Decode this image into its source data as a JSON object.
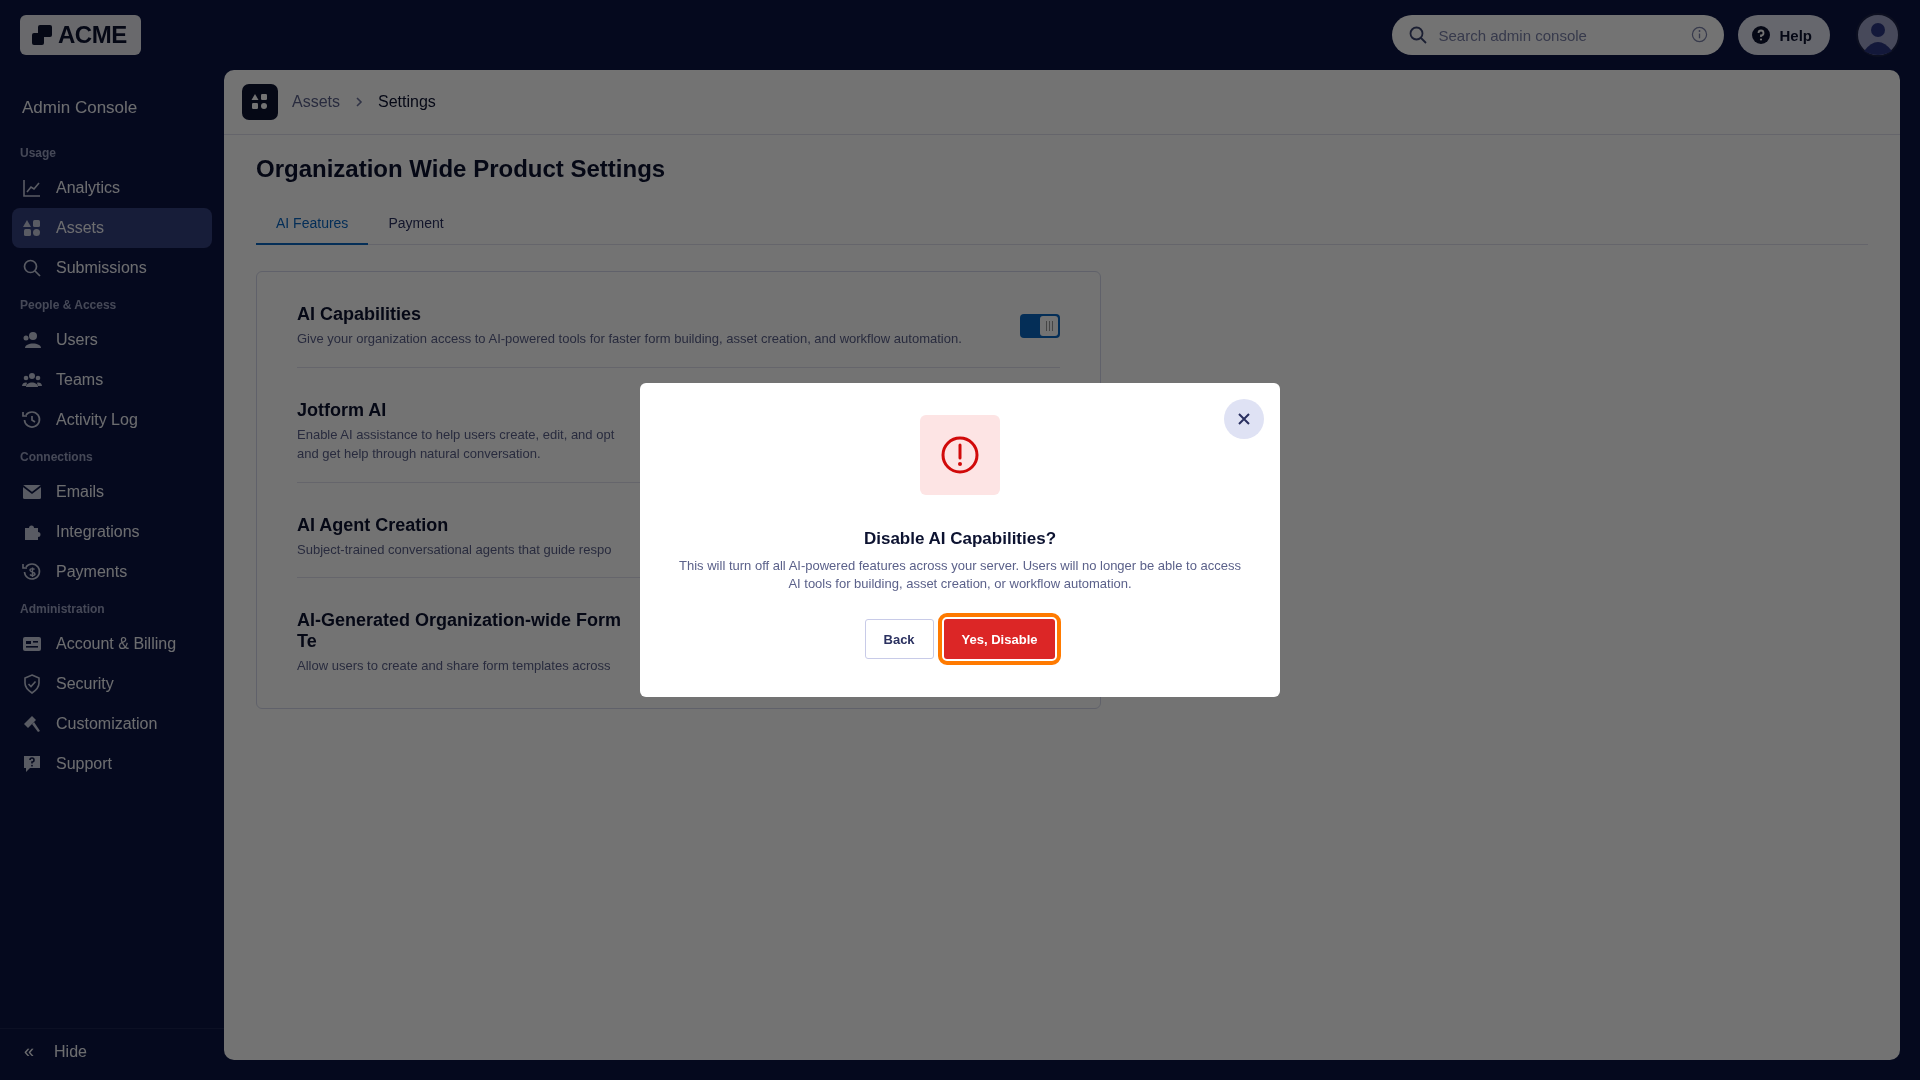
{
  "brand": {
    "logo_text": "ACME"
  },
  "search": {
    "placeholder": "Search admin console"
  },
  "help_button": {
    "label": "Help"
  },
  "sidebar": {
    "title": "Admin Console",
    "sections": [
      {
        "heading": "Usage",
        "items": [
          {
            "label": "Analytics",
            "selected": false
          },
          {
            "label": "Assets",
            "selected": true
          },
          {
            "label": "Submissions",
            "selected": false
          }
        ]
      },
      {
        "heading": "People & Access",
        "items": [
          {
            "label": "Users",
            "selected": false
          },
          {
            "label": "Teams",
            "selected": false
          },
          {
            "label": "Activity Log",
            "selected": false
          }
        ]
      },
      {
        "heading": "Connections",
        "items": [
          {
            "label": "Emails",
            "selected": false
          },
          {
            "label": "Integrations",
            "selected": false
          },
          {
            "label": "Payments",
            "selected": false
          }
        ]
      },
      {
        "heading": "Administration",
        "items": [
          {
            "label": "Account & Billing",
            "selected": false
          },
          {
            "label": "Security",
            "selected": false
          },
          {
            "label": "Customization",
            "selected": false
          },
          {
            "label": "Support",
            "selected": false
          }
        ]
      }
    ],
    "collapse": {
      "icon": "«",
      "label": "Hide"
    }
  },
  "breadcrumb": [
    "Assets",
    "Settings"
  ],
  "page_title": "Organization Wide Product Settings",
  "tabs": [
    {
      "label": "AI Features",
      "selected": true
    },
    {
      "label": "Payment",
      "selected": false
    }
  ],
  "settings": [
    {
      "kind": "toggle",
      "title": "AI Capabilities",
      "description": "Give your organization access to AI-powered tools for faster form building, asset creation, and workflow automation.",
      "on": true
    },
    {
      "kind": "plain",
      "title": "Jotform AI",
      "description": "Enable AI assistance to help users create, edit, and opt and get help through natural conversation."
    },
    {
      "kind": "plain",
      "title": "AI Agent Creation",
      "description": "Subject-trained conversational agents that guide respo"
    },
    {
      "kind": "plain",
      "title": "AI-Generated Organization-wide Form Te",
      "description": "Allow users to create and share form templates across"
    }
  ],
  "dialog": {
    "title": "Disable AI Capabilities?",
    "message": "This will turn off all AI-powered features across your server. Users will no longer be able to access AI tools for building, asset creation, or workflow automation.",
    "buttons": [
      {
        "kind": "secondary",
        "label": "Back"
      },
      {
        "kind": "danger",
        "label": "Yes, Disable",
        "focused": true
      }
    ]
  }
}
